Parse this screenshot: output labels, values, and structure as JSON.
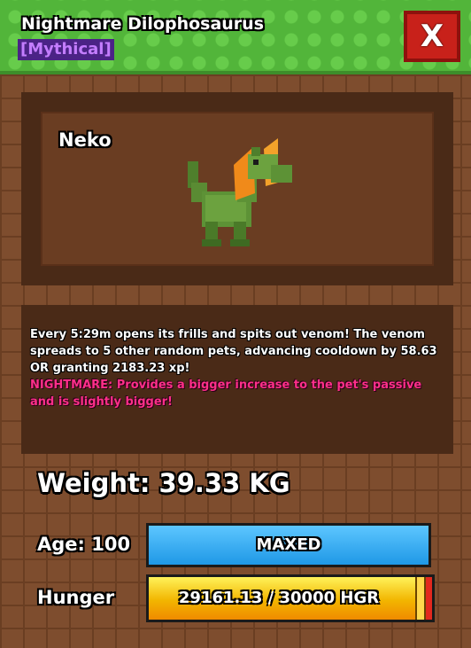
{
  "header": {
    "title": "Nightmare Dilophosaurus",
    "rarity": "[Mythical]",
    "close_label": "X"
  },
  "pet": {
    "name": "Neko",
    "image_icon": "dilophosaurus-pet-icon"
  },
  "description": {
    "text": "Every 5:29m opens its frills and spits out venom! The venom spreads to 5 other random pets, advancing cooldown by 58.63 OR granting 2183.23 xp!",
    "nightmare_prefix": "NIGHTMARE",
    "nightmare_text": ": Provides a bigger increase to the pet's passive and is slightly bigger!"
  },
  "stats": {
    "weight": "Weight: 39.33 KG",
    "age_label": "Age: 100",
    "age_bar_text": "MAXED",
    "hunger_label": "Hunger",
    "hunger_bar_text": "29161.13 / 30000 HGR",
    "hunger_current": 29161.13,
    "hunger_max": 30000
  },
  "colors": {
    "rarity_text": "#c47dff",
    "rarity_bg": "#4b2386",
    "close_button": "#c8211a",
    "nightmare_text": "#ff2f8a",
    "age_bar": "#1f98e6",
    "hunger_bar": "#f2b500"
  }
}
